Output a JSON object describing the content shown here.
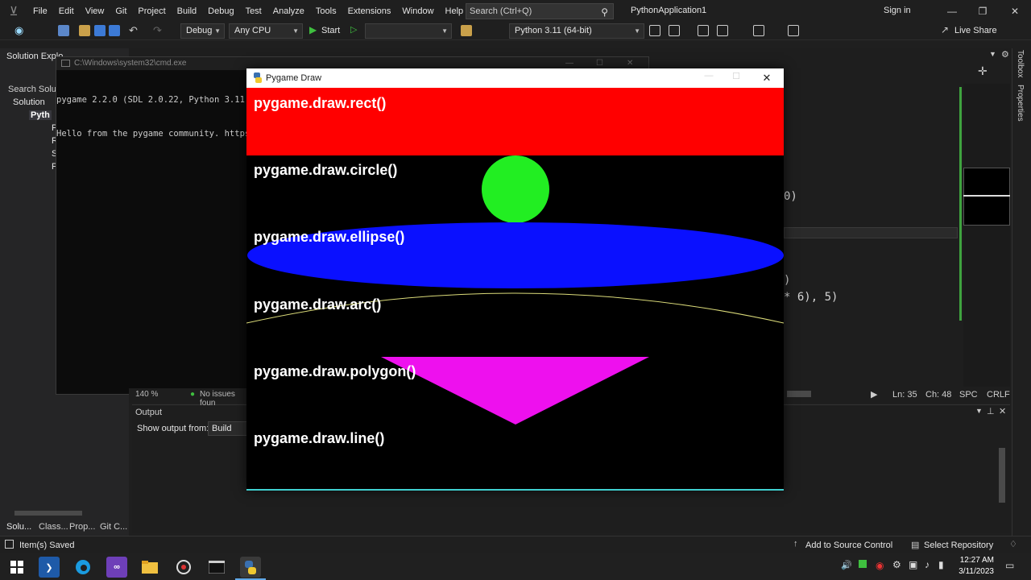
{
  "menubar": {
    "items": [
      "File",
      "Edit",
      "View",
      "Git",
      "Project",
      "Build",
      "Debug",
      "Test",
      "Analyze",
      "Tools",
      "Extensions",
      "Window",
      "Help"
    ],
    "search_placeholder": "Search (Ctrl+Q)",
    "solution_name": "PythonApplication1",
    "sign_in": "Sign in"
  },
  "toolbar": {
    "config": "Debug",
    "platform": "Any CPU",
    "start": "Start",
    "python_env": "Python 3.11 (64-bit)",
    "live_share": "Live Share"
  },
  "solution_explorer": {
    "title": "Solution Explo",
    "search": "Search Solutio",
    "items": [
      "Solution",
      "Pyth",
      "P",
      "R",
      "S",
      "P"
    ]
  },
  "editor": {
    "code_fragments": [
      "0)",
      ")",
      "* 6), 5)"
    ],
    "zoom": "140 %",
    "issues": "No issues foun",
    "line": "Ln: 35",
    "col": "Ch: 48",
    "spc": "SPC",
    "crlf": "CRLF"
  },
  "output": {
    "title": "Output",
    "show_from_label": "Show output from:",
    "show_from_value": "Build"
  },
  "right_strip": [
    "Toolbox",
    "Properties"
  ],
  "cmd": {
    "title": "C:\\Windows\\system32\\cmd.exe",
    "lines": [
      "pygame 2.2.0 (SDL 2.0.22, Python 3.11.1)",
      "Hello from the pygame community. https://"
    ]
  },
  "pygame_window": {
    "title": "Pygame Draw",
    "labels": [
      "pygame.draw.rect()",
      "pygame.draw.circle()",
      "pygame.draw.ellipse()",
      "pygame.draw.arc()",
      "pygame.draw.polygon()",
      "pygame.draw.line()"
    ],
    "colors": {
      "rect": "#ff0000",
      "circle": "#22ee22",
      "ellipse": "#0a10ff",
      "arc": "#dcdc7a",
      "polygon": "#ee10ee",
      "line": "#40d0d0"
    }
  },
  "bottom_tabs": [
    "Solu...",
    "Class...",
    "Prop...",
    "Git C..."
  ],
  "statusbar": {
    "message": "Item(s) Saved",
    "source_control": "Add to Source Control",
    "repository": "Select Repository"
  },
  "taskbar": {
    "time": "12:27 AM",
    "date": "3/11/2023"
  }
}
